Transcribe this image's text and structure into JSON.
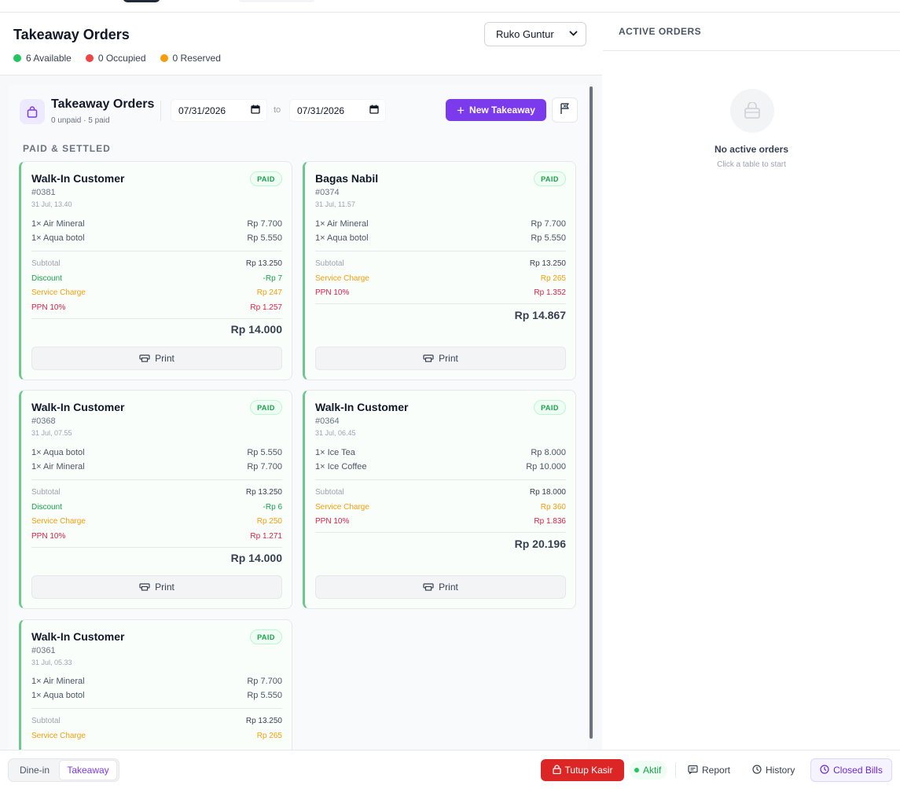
{
  "header": {
    "title": "Takeaway Orders",
    "status": {
      "available": "6 Available",
      "occupied": "0 Occupied",
      "reserved": "0 Reserved"
    },
    "status_colors": {
      "available": "#22c55e",
      "occupied": "#ef4444",
      "reserved": "#f59e0b"
    },
    "outlet_selected": "Ruko Guntur"
  },
  "takeaway": {
    "title": "Takeaway Orders",
    "subtitle": "0 unpaid · 5 paid",
    "date_from": "07/31/2026",
    "date_to": "07/31/2026",
    "to_label": "to",
    "new_button": "New Takeaway",
    "section_label": "PAID & SETTLED"
  },
  "orders": [
    {
      "name": "Walk-In Customer",
      "id": "#0381",
      "time": "31 Jul, 13.40",
      "badge": "PAID",
      "items": [
        {
          "label": "1× Air Mineral",
          "price": "Rp 7.700"
        },
        {
          "label": "1× Aqua botol",
          "price": "Rp 5.550"
        }
      ],
      "subtotal_label": "Subtotal",
      "subtotal": "Rp 13.250",
      "discount_label": "Discount",
      "discount": "-Rp 7",
      "service_label": "Service Charge",
      "service": "Rp 247",
      "ppn_label": "PPN 10%",
      "ppn": "Rp 1.257",
      "total": "Rp 14.000",
      "print_label": "Print"
    },
    {
      "name": "Bagas Nabil",
      "id": "#0374",
      "time": "31 Jul, 11.57",
      "badge": "PAID",
      "items": [
        {
          "label": "1× Air Mineral",
          "price": "Rp 7.700"
        },
        {
          "label": "1× Aqua botol",
          "price": "Rp 5.550"
        }
      ],
      "subtotal_label": "Subtotal",
      "subtotal": "Rp 13.250",
      "service_label": "Service Charge",
      "service": "Rp 265",
      "ppn_label": "PPN 10%",
      "ppn": "Rp 1.352",
      "total": "Rp 14.867",
      "print_label": "Print"
    },
    {
      "name": "Walk-In Customer",
      "id": "#0368",
      "time": "31 Jul, 07.55",
      "badge": "PAID",
      "items": [
        {
          "label": "1× Aqua botol",
          "price": "Rp 5.550"
        },
        {
          "label": "1× Air Mineral",
          "price": "Rp 7.700"
        }
      ],
      "subtotal_label": "Subtotal",
      "subtotal": "Rp 13.250",
      "discount_label": "Discount",
      "discount": "-Rp 6",
      "service_label": "Service Charge",
      "service": "Rp 250",
      "ppn_label": "PPN 10%",
      "ppn": "Rp 1.271",
      "total": "Rp 14.000",
      "print_label": "Print"
    },
    {
      "name": "Walk-In Customer",
      "id": "#0364",
      "time": "31 Jul, 06.45",
      "badge": "PAID",
      "items": [
        {
          "label": "1× Ice Tea",
          "price": "Rp 8.000"
        },
        {
          "label": "1× Ice Coffee",
          "price": "Rp 10.000"
        }
      ],
      "subtotal_label": "Subtotal",
      "subtotal": "Rp 18.000",
      "service_label": "Service Charge",
      "service": "Rp 360",
      "ppn_label": "PPN 10%",
      "ppn": "Rp 1.836",
      "total": "Rp 20.196",
      "print_label": "Print"
    },
    {
      "name": "Walk-In Customer",
      "id": "#0361",
      "time": "31 Jul, 05.33",
      "badge": "PAID",
      "items": [
        {
          "label": "1× Air Mineral",
          "price": "Rp 7.700"
        },
        {
          "label": "1× Aqua botol",
          "price": "Rp 5.550"
        }
      ],
      "subtotal_label": "Subtotal",
      "subtotal": "Rp 13.250",
      "service_label": "Service Charge",
      "service": "Rp 265"
    }
  ],
  "right": {
    "title": "ACTIVE ORDERS",
    "empty_title": "No active orders",
    "empty_sub": "Click a table to start"
  },
  "bottom": {
    "dine_in": "Dine-in",
    "takeaway": "Takeaway",
    "tutup": "Tutup Kasir",
    "aktif": "Aktif",
    "report": "Report",
    "history": "History",
    "closed_bills": "Closed Bills"
  },
  "colors": {
    "accent": "#7c3aed",
    "paid_green": "#16a34a",
    "danger": "#dc2626"
  }
}
